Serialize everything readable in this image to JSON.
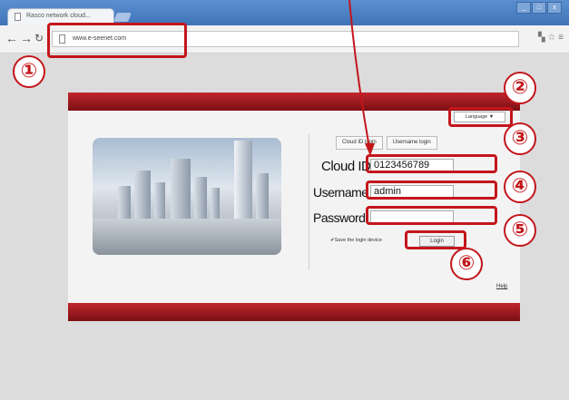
{
  "browser": {
    "tab_title": "Rasco network cloud...",
    "address": "www.e-seenet.com",
    "window_controls": [
      "_",
      "□",
      "x"
    ]
  },
  "login_page": {
    "language_label": "Language ▼",
    "tabs": [
      "Cloud ID login",
      "Username login"
    ],
    "cloud_id_label": "Cloud ID",
    "cloud_id_value": "0123456789",
    "username_label": "Username",
    "username_value": "admin",
    "password_label": "Password",
    "password_value": "",
    "save_checkbox_label": "✔Save the login device",
    "login_button": "Login",
    "help_link": "Help"
  },
  "annotations": [
    "①",
    "②",
    "③",
    "④",
    "⑤",
    "⑥"
  ],
  "colors": {
    "accent": "#c3161c",
    "header_bar": "#a01a1f"
  }
}
